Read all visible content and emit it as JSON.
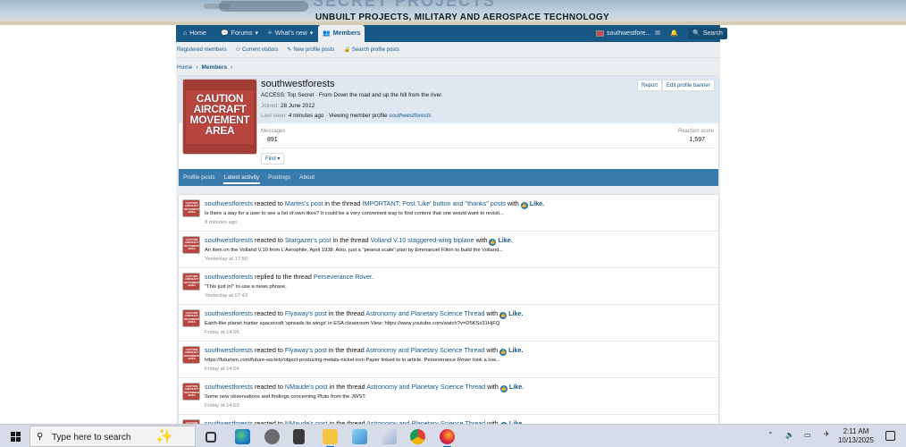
{
  "banner": {
    "tagline": "UNBUILT PROJECTS, MILITARY AND AEROSPACE TECHNOLOGY"
  },
  "nav": {
    "items": [
      {
        "label": "Home",
        "icon": "house-icon"
      },
      {
        "label": "Forums",
        "icon": "chat-bubbles-icon"
      },
      {
        "label": "What's new",
        "icon": "lightbulb-icon"
      },
      {
        "label": "Members",
        "icon": "people-icon",
        "active": true
      }
    ],
    "user_label": "southwestfore...",
    "search_label": "Search"
  },
  "subnav": {
    "items": [
      "Registered members",
      "Current visitors",
      "New profile posts",
      "Search profile posts"
    ]
  },
  "breadcrumb": {
    "home": "Home",
    "members": "Members"
  },
  "profile": {
    "username": "southwestforests",
    "avatar_text": [
      "CAUTION",
      "AIRCRAFT",
      "MOVEMENT",
      "AREA"
    ],
    "access": "ACCESS: Top Secret · From Down the road and up the hill from the river.",
    "joined_label": "Joined:",
    "joined_value": "28 June 2012",
    "last_seen_label": "Last seen:",
    "last_seen_value": "4 minutes ago · Viewing member profile",
    "last_seen_link": "southwestforests",
    "report_label": "Report",
    "edit_banner_label": "Edit profile banner",
    "messages_label": "Messages",
    "messages_value": "891",
    "reaction_label": "Reaction score",
    "reaction_value": "1,597",
    "find_label": "Find",
    "tabs": [
      "Profile posts",
      "Latest activity",
      "Postings",
      "About"
    ],
    "active_tab": "Latest activity"
  },
  "activity": [
    {
      "user": "southwestforests",
      "action": "reacted to",
      "target": "Martes's post",
      "mid": "in the thread",
      "thread": "IMPORTANT: Post 'Like' button and \"thanks\" posts",
      "tail": "with",
      "reaction": "Like.",
      "snippet": "Is there a way for a user to see a list of own likes? It could be a very convenient way to find content that one would want to revisit...",
      "time": "8 minutes ago"
    },
    {
      "user": "southwestforests",
      "action": "reacted to",
      "target": "Stargazer's post",
      "mid": "in the thread",
      "thread": "Volland V.10 staggered-wing biplane",
      "tail": "with",
      "reaction": "Like.",
      "snippet": "An item on the Volland V.10 from L'Aérophile, April 1938: Also, just a \"peanut scale\" plan by Emmanuel Fillon to build the Volland...",
      "time": "Yesterday at 17:50"
    },
    {
      "user": "southwestforests",
      "action": "replied to the thread",
      "target": "",
      "mid": "",
      "thread": "Perseverance Rover",
      "tail": "",
      "reaction": "",
      "snippet": "\"This just in!\" to use a news phrase,",
      "time": "Yesterday at 07:43"
    },
    {
      "user": "southwestforests",
      "action": "reacted to",
      "target": "Flyaway's post",
      "mid": "in the thread",
      "thread": "Astronomy and Planetary Science Thread",
      "tail": "with",
      "reaction": "Like.",
      "snippet": "Earth-like planet hunter spacecraft 'spreads its wings' in ESA cleanroom View: https://www.youtube.com/watch?v=D5KSx31HjFQ",
      "time": "Friday at 14:06"
    },
    {
      "user": "southwestforests",
      "action": "reacted to",
      "target": "Flyaway's post",
      "mid": "in the thread",
      "thread": "Astronomy and Planetary Science Thread",
      "tail": "with",
      "reaction": "Like.",
      "snippet": "https://futurism.com/future-society/object-producing-metals-nickel-iron Paper linked to in article. Perseverance Rover took a low...",
      "time": "Friday at 14:04"
    },
    {
      "user": "southwestforests",
      "action": "reacted to",
      "target": "NMaude's post",
      "mid": "in the thread",
      "thread": "Astronomy and Planetary Science Thread",
      "tail": "with",
      "reaction": "Like.",
      "snippet": "Some new observations and findings concerning Pluto from the JWST:",
      "time": "Friday at 14:03"
    },
    {
      "user": "southwestforests",
      "action": "reacted to",
      "target": "NMaude's post",
      "mid": "in the thread",
      "thread": "Astronomy and Planetary Science Thread",
      "tail": "with",
      "reaction": "Like.",
      "snippet": "",
      "time": ""
    }
  ],
  "taskbar": {
    "search_placeholder": "Type here to search",
    "time": "2:11 AM",
    "date": "10/13/2025"
  }
}
